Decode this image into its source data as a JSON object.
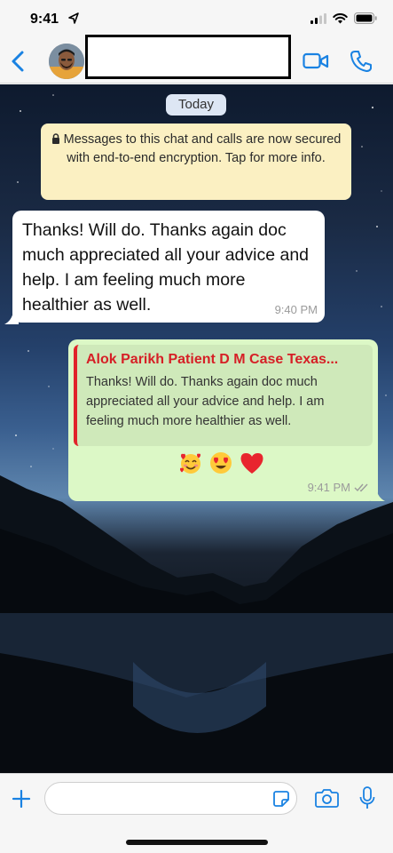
{
  "status_bar": {
    "time": "9:41",
    "icons": [
      "location-arrow-icon",
      "signal-icon",
      "wifi-icon",
      "battery-icon"
    ]
  },
  "nav": {
    "contact_name": "",
    "icons": [
      "back-chevron-icon",
      "video-call-icon",
      "phone-call-icon"
    ]
  },
  "chat": {
    "date_label": "Today",
    "encryption_notice": "Messages to this chat and calls are now secured with end-to-end encryption. Tap for more info.",
    "incoming_message": {
      "text": "Thanks! Will do. Thanks again doc much appreciated all your advice and help. I am feeling much more healthier as well.",
      "time": "9:40 PM"
    },
    "outgoing_message": {
      "quoted_author": "Alok Parikh Patient D M Case Texas...",
      "quoted_text": "Thanks! Will do. Thanks again doc much appreciated all your advice and help. I am feeling much more healthier as well.",
      "emojis": [
        "smiling-face-with-hearts",
        "heart-eyes",
        "red-heart"
      ],
      "time": "9:41 PM",
      "status": "read-double-check"
    }
  },
  "input_bar": {
    "placeholder": "",
    "icons": [
      "plus-icon",
      "sticker-icon",
      "camera-icon",
      "microphone-icon"
    ]
  },
  "colors": {
    "accent": "#1a82e2",
    "incoming_bubble": "#ffffff",
    "outgoing_bubble": "#dcf8c6",
    "quote_bar": "#e1232a",
    "notice_bg": "#fbf0c2"
  }
}
